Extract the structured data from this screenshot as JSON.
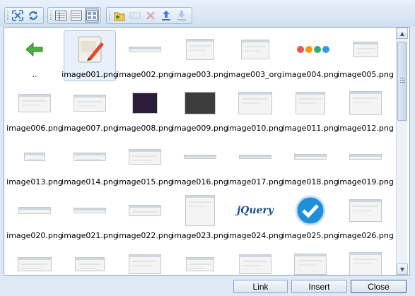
{
  "toolbar": {
    "groups": [
      {
        "icons": [
          "fullscreen-icon",
          "refresh-icon"
        ]
      },
      {
        "icons": [
          "view-details-icon",
          "view-list-icon",
          "view-thumbnails-icon"
        ],
        "active": "view-thumbnails-icon"
      },
      {
        "icons": [
          "new-folder-icon",
          "rename-icon",
          "delete-icon",
          "upload-icon",
          "download-icon"
        ]
      }
    ]
  },
  "files": [
    {
      "label": "..",
      "icon": "up-arrow-icon"
    },
    {
      "label": "image001.png",
      "selected": true,
      "icon": "image-file-icon"
    },
    {
      "label": "image002.png"
    },
    {
      "label": "image003.png"
    },
    {
      "label": "image003_org."
    },
    {
      "label": "image004.png"
    },
    {
      "label": "image005.png"
    },
    {
      "label": "image006.png"
    },
    {
      "label": "image007.png"
    },
    {
      "label": "image008.png"
    },
    {
      "label": "image009.png"
    },
    {
      "label": "image010.png"
    },
    {
      "label": "image011.png"
    },
    {
      "label": "image012.png"
    },
    {
      "label": "image013.png"
    },
    {
      "label": "image014.png"
    },
    {
      "label": "image015.png"
    },
    {
      "label": "image016.png"
    },
    {
      "label": "image017.png"
    },
    {
      "label": "image018.png"
    },
    {
      "label": "image019.png"
    },
    {
      "label": "image020.png"
    },
    {
      "label": "image021.png"
    },
    {
      "label": "image022.png"
    },
    {
      "label": "image023.png"
    },
    {
      "label": "image024.png",
      "logo_text": "jQuery"
    },
    {
      "label": "image025.png",
      "icon": "checkmark-icon"
    },
    {
      "label": "image026.png"
    },
    {
      "label": ""
    },
    {
      "label": ""
    },
    {
      "label": ""
    },
    {
      "label": ""
    },
    {
      "label": ""
    },
    {
      "label": ""
    },
    {
      "label": ""
    }
  ],
  "buttons": {
    "link": "Link",
    "insert": "Insert",
    "close": "Close"
  },
  "colors": {
    "accent": "#1f8fd8",
    "folder_up": "#4caf3f"
  }
}
